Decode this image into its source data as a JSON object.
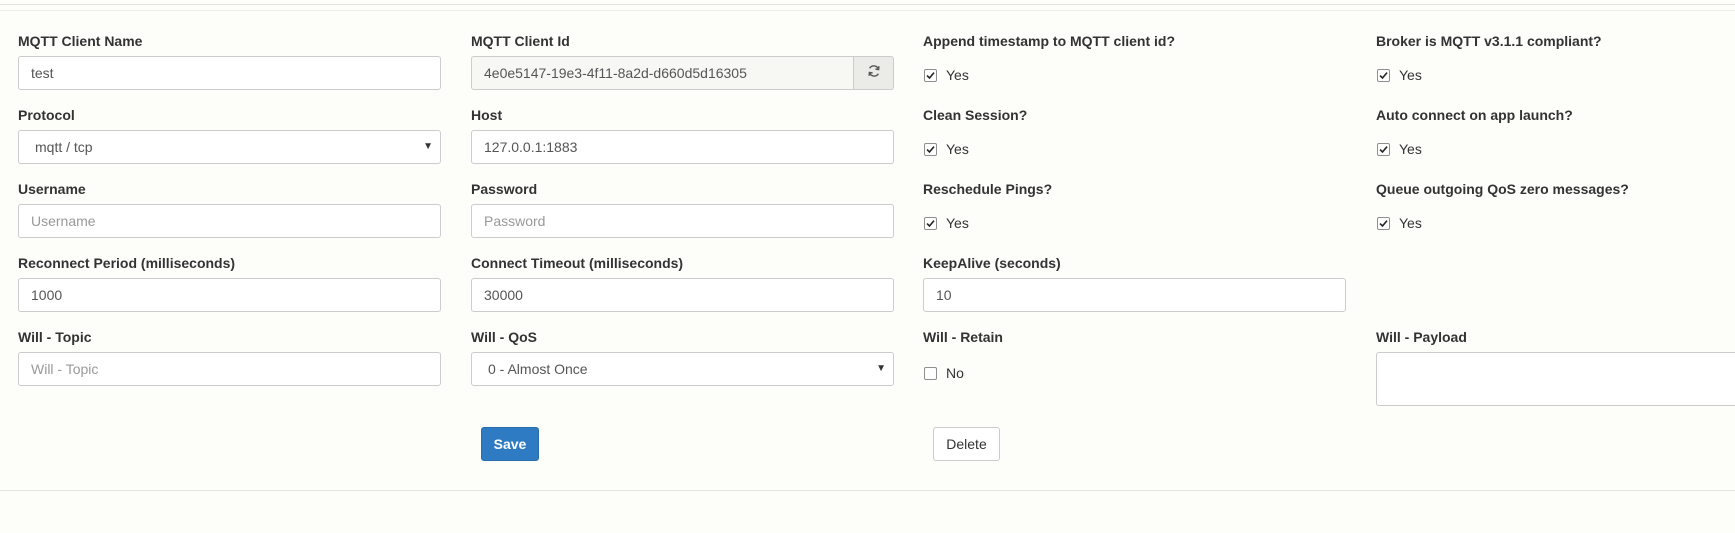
{
  "fields": {
    "client_name": {
      "label": "MQTT Client Name",
      "value": "test"
    },
    "client_id": {
      "label": "MQTT Client Id",
      "value": "4e0e5147-19e3-4f11-8a2d-d660d5d16305"
    },
    "append_timestamp": {
      "label": "Append timestamp to MQTT client id?",
      "option": "Yes",
      "checked": true
    },
    "mqtt311": {
      "label": "Broker is MQTT v3.1.1 compliant?",
      "option": "Yes",
      "checked": true
    },
    "protocol": {
      "label": "Protocol",
      "value": "mqtt / tcp"
    },
    "host": {
      "label": "Host",
      "value": "127.0.0.1:1883"
    },
    "clean_session": {
      "label": "Clean Session?",
      "option": "Yes",
      "checked": true
    },
    "auto_connect": {
      "label": "Auto connect on app launch?",
      "option": "Yes",
      "checked": true
    },
    "username": {
      "label": "Username",
      "placeholder": "Username"
    },
    "password": {
      "label": "Password",
      "placeholder": "Password"
    },
    "reschedule_pings": {
      "label": "Reschedule Pings?",
      "option": "Yes",
      "checked": true
    },
    "queue_qos_zero": {
      "label": "Queue outgoing QoS zero messages?",
      "option": "Yes",
      "checked": true
    },
    "reconnect_period": {
      "label": "Reconnect Period (milliseconds)",
      "value": "1000"
    },
    "connect_timeout": {
      "label": "Connect Timeout (milliseconds)",
      "value": "30000"
    },
    "keepalive": {
      "label": "KeepAlive (seconds)",
      "value": "10"
    },
    "will_topic": {
      "label": "Will - Topic",
      "placeholder": "Will - Topic"
    },
    "will_qos": {
      "label": "Will - QoS",
      "value": "0 - Almost Once"
    },
    "will_retain": {
      "label": "Will - Retain",
      "option": "No",
      "checked": false
    },
    "will_payload": {
      "label": "Will - Payload",
      "value": ""
    }
  },
  "buttons": {
    "save_label": "Save",
    "delete_label": "Delete"
  },
  "icons": {
    "regenerate": "refresh-icon",
    "select_caret": "caret-down-icon"
  },
  "colors": {
    "primary": "#2e7bc4",
    "background": "#fdfdfa",
    "border": "#cccccc"
  }
}
